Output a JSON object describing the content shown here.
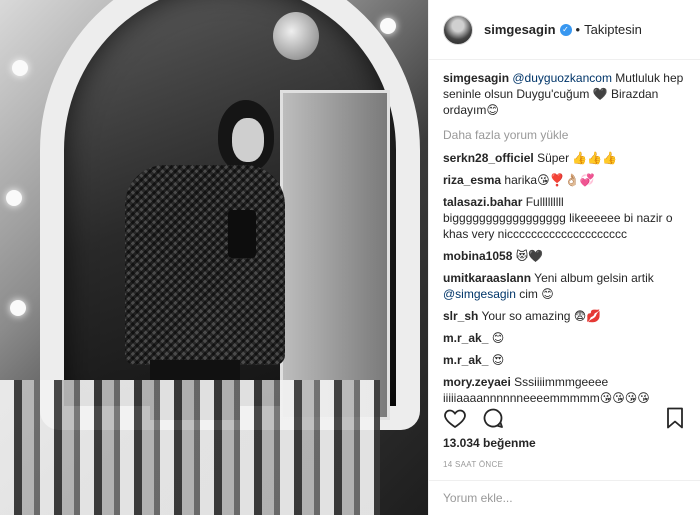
{
  "post": {
    "username": "simgesagin",
    "verified_icon": "verified-badge-icon",
    "separator": "•",
    "follow_status": "Takiptesin"
  },
  "caption": {
    "username": "simgesagin",
    "mention": "@duyguozkancom",
    "text": " Mutluluk hep seninle olsun Duygu'cuğum 🖤 Birazdan ordayım😊"
  },
  "load_more": "Daha fazla yorum yükle",
  "comments": [
    {
      "user": "serkn28_officiel",
      "text": "Süper 👍👍👍"
    },
    {
      "user": "riza_esma",
      "text": "harika😘❣️👌🏼💞"
    },
    {
      "user": "talasazi.bahar",
      "text": "Fulllllllll"
    },
    {
      "user": "",
      "text": "biggggggggggggggggg likeeeeee bi nazir o khas very nicccccccccccccccccccc"
    },
    {
      "user": "mobina1058",
      "text": "😻🖤"
    },
    {
      "user": "umitkaraaslann",
      "text": "Yeni album gelsin artik"
    },
    {
      "user": "",
      "mention": "@simgesagin",
      "text": " cim 😊"
    },
    {
      "user": "slr_sh",
      "text": "Your so amazing 😨💋"
    },
    {
      "user": "m.r_ak_",
      "text": "😊"
    },
    {
      "user": "m.r_ak_",
      "text": "😍"
    },
    {
      "user": "mory.zeyaei",
      "text": "Sssiiiimmmgeeee iiiiiaaaannnnnneeeemmmmm😘😘😘😘"
    }
  ],
  "actions": {
    "like_icon": "heart-icon",
    "comment_icon": "comment-icon",
    "bookmark_icon": "bookmark-icon"
  },
  "likes_text": "13.034 beğenme",
  "time_text": "14 SAAT ÖNCE",
  "comment_input": {
    "placeholder": "Yorum ekle..."
  }
}
